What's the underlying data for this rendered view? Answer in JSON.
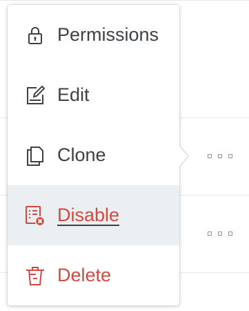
{
  "colors": {
    "text": "#3d4046",
    "danger": "#d24a3f",
    "hover_background": "#eceff2",
    "menu_background": "#ffffff"
  },
  "menu": {
    "items": [
      {
        "label": "Permissions",
        "icon": "lock-icon",
        "style": "default",
        "hovered": false
      },
      {
        "label": "Edit",
        "icon": "edit-icon",
        "style": "default",
        "hovered": false
      },
      {
        "label": "Clone",
        "icon": "copy-icon",
        "style": "default",
        "hovered": false
      },
      {
        "label": "Disable",
        "icon": "disable-list-icon",
        "style": "danger",
        "hovered": true
      },
      {
        "label": "Delete",
        "icon": "trash-icon",
        "style": "danger",
        "hovered": false
      }
    ]
  },
  "rows": {
    "action_icon": "more-options-icon"
  }
}
